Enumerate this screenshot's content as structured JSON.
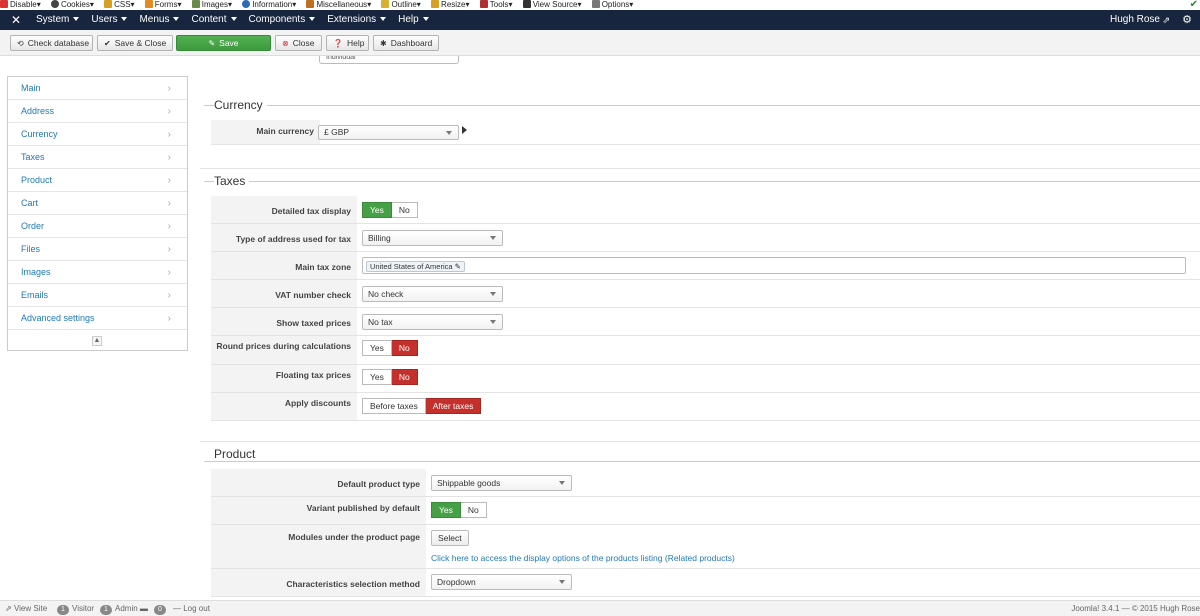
{
  "devbar": {
    "items": [
      "Disable",
      "Cookies",
      "CSS",
      "Forms",
      "Images",
      "Information",
      "Miscellaneous",
      "Outline",
      "Resize",
      "Tools",
      "View Source",
      "Options"
    ]
  },
  "navbar": {
    "menus": [
      "System",
      "Users",
      "Menus",
      "Content",
      "Components",
      "Extensions",
      "Help"
    ],
    "user": "Hugh Rose"
  },
  "toolbar": {
    "check_database": "Check database",
    "save_close": "Save & Close",
    "save": "Save",
    "close": "Close",
    "help": "Help",
    "dashboard": "Dashboard"
  },
  "sidebar": {
    "items": [
      "Main",
      "Address",
      "Currency",
      "Taxes",
      "Product",
      "Cart",
      "Order",
      "Files",
      "Images",
      "Emails",
      "Advanced settings"
    ]
  },
  "top_field": {
    "value": "Individual"
  },
  "currency": {
    "legend": "Currency",
    "main_currency_label": "Main currency",
    "main_currency_value": "£ GBP"
  },
  "taxes": {
    "legend": "Taxes",
    "detailed_tax_display": {
      "label": "Detailed tax display",
      "yes": "Yes",
      "no": "No"
    },
    "address_type": {
      "label": "Type of address used for tax",
      "value": "Billing"
    },
    "main_tax_zone": {
      "label": "Main tax zone",
      "tag": "United States of America"
    },
    "vat_check": {
      "label": "VAT number check",
      "value": "No check"
    },
    "show_taxed_prices": {
      "label": "Show taxed prices",
      "value": "No tax"
    },
    "round_prices": {
      "label": "Round prices during calculations",
      "yes": "Yes",
      "no": "No"
    },
    "floating_tax": {
      "label": "Floating tax prices",
      "yes": "Yes",
      "no": "No"
    },
    "apply_discounts": {
      "label": "Apply discounts",
      "before": "Before taxes",
      "after": "After taxes"
    }
  },
  "product": {
    "legend": "Product",
    "default_type": {
      "label": "Default product type",
      "value": "Shippable goods"
    },
    "variant_published": {
      "label": "Variant published by default",
      "yes": "Yes",
      "no": "No"
    },
    "modules": {
      "label": "Modules under the product page",
      "button": "Select",
      "link": "Click here to access the display options of the products listing (Related products)"
    },
    "characteristics": {
      "label": "Characteristics selection method",
      "value": "Dropdown"
    }
  },
  "status": {
    "view_site": "View Site",
    "visitor_count": "1",
    "visitor": "Visitor",
    "admin_count": "1",
    "admin": "Admin",
    "messages_count": "0",
    "logout": "Log out",
    "version": "Joomla! 3.4.1 — © 2015 Hugh Rose"
  }
}
